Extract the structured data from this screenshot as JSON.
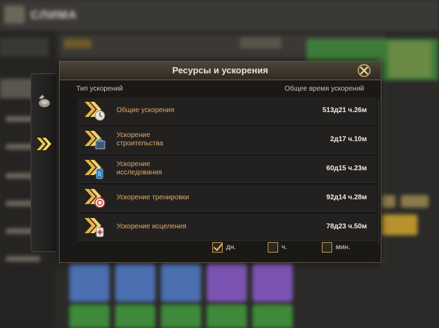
{
  "background": {
    "game_title": "СЛИМА"
  },
  "dialog": {
    "title": "Ресурсы и ускорения",
    "columns": {
      "type": "Тип ускорений",
      "total_time": "Общее время ускорений"
    },
    "rows": [
      {
        "label": "Общие ускорения",
        "time": "513д21 ч.26м",
        "icon": "general-speedup-icon"
      },
      {
        "label": "Ускорение\nстроительства",
        "time": "2д17 ч.10м",
        "icon": "building-speedup-icon"
      },
      {
        "label": "Ускорение\nисследования",
        "time": "60д15 ч.23м",
        "icon": "research-speedup-icon"
      },
      {
        "label": "Ускорение тренировки",
        "time": "92д14 ч.28м",
        "icon": "training-speedup-icon"
      },
      {
        "label": "Ускорение исцеления",
        "time": "78д23 ч.50м",
        "icon": "healing-speedup-icon"
      }
    ],
    "units": [
      {
        "label": "дн.",
        "checked": true
      },
      {
        "label": "ч.",
        "checked": false
      },
      {
        "label": "мин.",
        "checked": false
      }
    ]
  },
  "colors": {
    "accent_gold": "#f0c06a",
    "label_orange": "#e3aa66",
    "dialog_bg": "#1a1918"
  }
}
